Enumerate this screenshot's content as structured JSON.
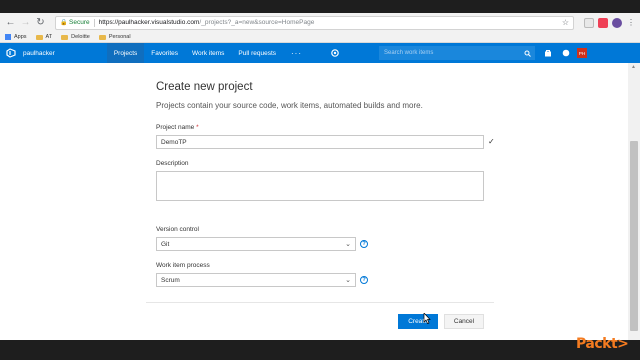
{
  "browser": {
    "secure_label": "Secure",
    "url_host": "https://paulhacker.visualstudio.com",
    "url_rest": "/_projects?_a=new&source=HomePage",
    "bookmarks": [
      {
        "label": "Apps",
        "icon": "apps-grid-icon"
      },
      {
        "label": "AT",
        "icon": "folder-icon"
      },
      {
        "label": "Deloitte",
        "icon": "folder-icon"
      },
      {
        "label": "Personal",
        "icon": "folder-icon"
      }
    ]
  },
  "header": {
    "account": "paulhacker",
    "hubs": [
      {
        "label": "Projects",
        "active": true
      },
      {
        "label": "Favorites",
        "active": false
      },
      {
        "label": "Work items",
        "active": false
      },
      {
        "label": "Pull requests",
        "active": false
      }
    ],
    "more": "···",
    "search_placeholder": "Search work items",
    "avatar_initials": "PH",
    "accent_color": "#0078d7"
  },
  "form": {
    "title": "Create new project",
    "subtitle": "Projects contain your source code, work items, automated builds and more.",
    "project_name_label": "Project name",
    "required_mark": "*",
    "project_name_value": "DemoTP",
    "description_label": "Description",
    "description_value": "",
    "version_control_label": "Version control",
    "version_control_value": "Git",
    "process_label": "Work item process",
    "process_value": "Scrum",
    "create_label": "Create",
    "cancel_label": "Cancel"
  },
  "watermark": "Packt>"
}
